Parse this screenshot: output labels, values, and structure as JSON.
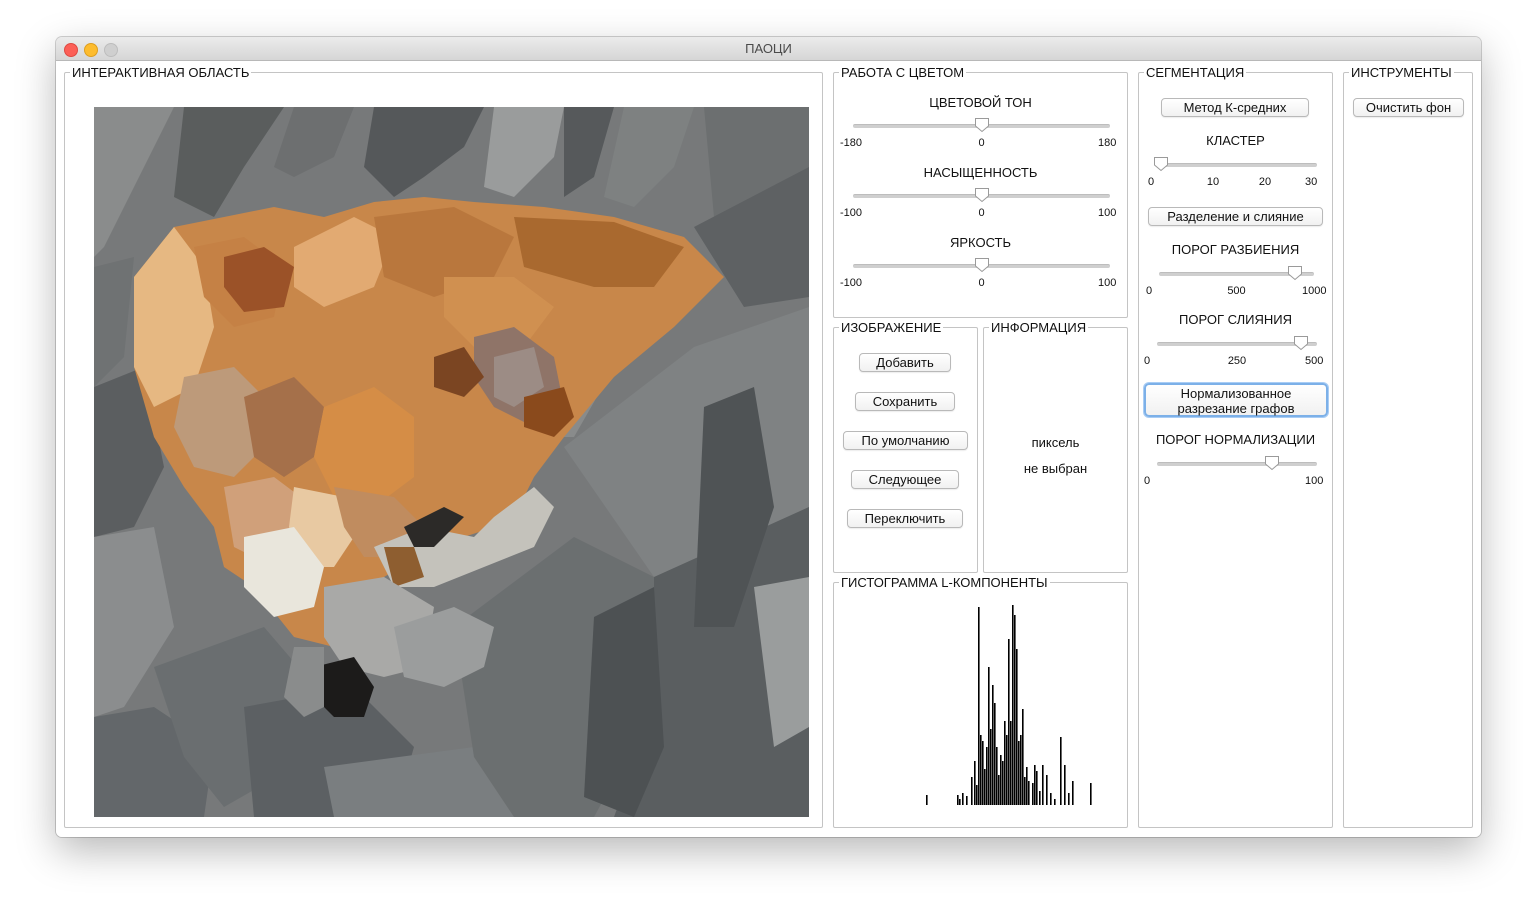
{
  "window": {
    "title": "ПАОЦИ"
  },
  "interactive_area": {
    "title": "ИНТЕРАКТИВНАЯ ОБЛАСТЬ"
  },
  "color_panel": {
    "title": "РАБОТА С ЦВЕТОМ",
    "sliders": [
      {
        "label": "ЦВЕТОВОЙ ТОН",
        "min": "-180",
        "mid": "0",
        "max": "180",
        "value": 0.5
      },
      {
        "label": "НАСЫЩЕННОСТЬ",
        "min": "-100",
        "mid": "0",
        "max": "100",
        "value": 0.5
      },
      {
        "label": "ЯРКОСТЬ",
        "min": "-100",
        "mid": "0",
        "max": "100",
        "value": 0.5
      }
    ]
  },
  "image_panel": {
    "title": "ИЗОБРАЖЕНИЕ",
    "buttons": [
      "Добавить",
      "Сохранить",
      "По умолчанию",
      "Следующее",
      "Переключить"
    ]
  },
  "info_panel": {
    "title": "ИНФОРМАЦИЯ",
    "line1": "пиксель",
    "line2": "не выбран"
  },
  "histogram_panel": {
    "title": "ГИСТОГРАММА L-КОМПОНЕНТЫ",
    "bins": [
      [
        70,
        10
      ],
      [
        101,
        10
      ],
      [
        103,
        6
      ],
      [
        106,
        12
      ],
      [
        110,
        9
      ],
      [
        115,
        28
      ],
      [
        118,
        44
      ],
      [
        120,
        20
      ],
      [
        122,
        198
      ],
      [
        124,
        70
      ],
      [
        126,
        64
      ],
      [
        128,
        36
      ],
      [
        130,
        58
      ],
      [
        132,
        138
      ],
      [
        134,
        76
      ],
      [
        136,
        120
      ],
      [
        138,
        102
      ],
      [
        140,
        58
      ],
      [
        142,
        30
      ],
      [
        144,
        50
      ],
      [
        146,
        44
      ],
      [
        148,
        84
      ],
      [
        150,
        70
      ],
      [
        152,
        166
      ],
      [
        154,
        84
      ],
      [
        156,
        200
      ],
      [
        158,
        190
      ],
      [
        160,
        156
      ],
      [
        162,
        64
      ],
      [
        164,
        70
      ],
      [
        166,
        96
      ],
      [
        168,
        28
      ],
      [
        170,
        38
      ],
      [
        172,
        24
      ],
      [
        176,
        22
      ],
      [
        178,
        40
      ],
      [
        180,
        34
      ],
      [
        183,
        14
      ],
      [
        186,
        40
      ],
      [
        190,
        30
      ],
      [
        194,
        12
      ],
      [
        198,
        6
      ],
      [
        204,
        68
      ],
      [
        208,
        40
      ],
      [
        212,
        12
      ],
      [
        216,
        24
      ],
      [
        234,
        22
      ]
    ]
  },
  "segmentation_panel": {
    "title": "СЕГМЕНТАЦИЯ",
    "kmeans_button": "Метод К-средних",
    "cluster": {
      "label": "КЛАСТЕР",
      "ticks": [
        "0",
        "10",
        "20",
        "30"
      ],
      "value": 0.0
    },
    "split_merge_button": "Разделение и слияние",
    "split_threshold": {
      "label": "ПОРОГ РАЗБИЕНИЯ",
      "ticks": [
        "0",
        "500",
        "1000"
      ],
      "value": 0.88
    },
    "merge_threshold": {
      "label": "ПОРОГ СЛИЯНИЯ",
      "ticks": [
        "0",
        "250",
        "500"
      ],
      "value": 0.9
    },
    "normalized_cut_button_line1": "Нормализованное",
    "normalized_cut_button_line2": "разрезание графов",
    "normalization_threshold": {
      "label": "ПОРОГ НОРМАЛИЗАЦИИ",
      "ticks": [
        "0",
        "100"
      ],
      "value": 0.72
    }
  },
  "tools_panel": {
    "title": "ИНСТРУМЕНТЫ",
    "clear_bg_button": "Очистить фон"
  }
}
